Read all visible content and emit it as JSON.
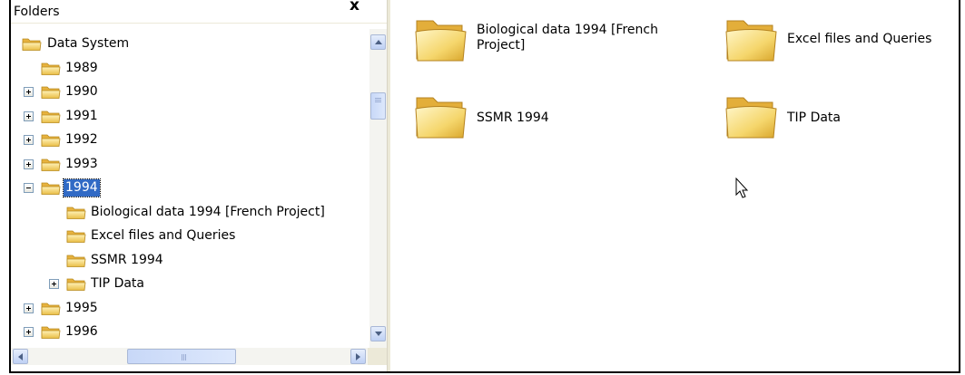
{
  "folders_pane": {
    "title": "Folders",
    "close_glyph": "x"
  },
  "tree": [
    {
      "label": "Data System",
      "level": 0,
      "expander": "none",
      "selected": false
    },
    {
      "label": "1989",
      "level": 1,
      "expander": "none",
      "selected": false
    },
    {
      "label": "1990",
      "level": 1,
      "expander": "plus",
      "selected": false
    },
    {
      "label": "1991",
      "level": 1,
      "expander": "plus",
      "selected": false
    },
    {
      "label": "1992",
      "level": 1,
      "expander": "plus",
      "selected": false
    },
    {
      "label": "1993",
      "level": 1,
      "expander": "plus",
      "selected": false
    },
    {
      "label": "1994",
      "level": 1,
      "expander": "minus",
      "selected": true
    },
    {
      "label": "Biological data 1994 [French Project]",
      "level": 2,
      "expander": "none",
      "selected": false
    },
    {
      "label": "Excel files and Queries",
      "level": 2,
      "expander": "none",
      "selected": false
    },
    {
      "label": "SSMR 1994",
      "level": 2,
      "expander": "none",
      "selected": false
    },
    {
      "label": "TIP Data",
      "level": 2,
      "expander": "plus",
      "selected": false
    },
    {
      "label": "1995",
      "level": 1,
      "expander": "plus",
      "selected": false
    },
    {
      "label": "1996",
      "level": 1,
      "expander": "plus",
      "selected": false
    }
  ],
  "content_items": [
    {
      "label": "Biological data 1994 [French Project]"
    },
    {
      "label": "Excel files and Queries"
    },
    {
      "label": "SSMR 1994"
    },
    {
      "label": "TIP Data"
    }
  ],
  "icons": {
    "folder": "folder-icon",
    "expand": "plus-box-icon",
    "collapse": "minus-box-icon",
    "cursor": "mouse-pointer-icon"
  },
  "colors": {
    "selection": "#316ac5",
    "folder_fill": "#f5d66c",
    "scrollbar": "#bed0f4"
  }
}
